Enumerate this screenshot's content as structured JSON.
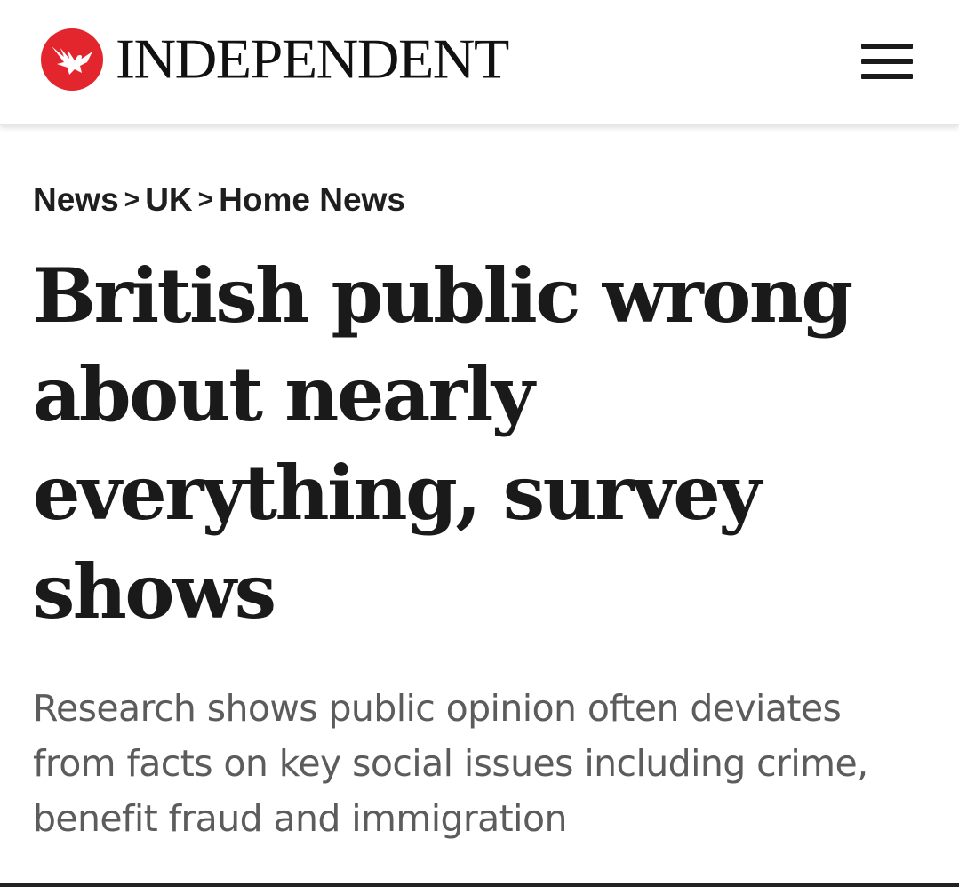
{
  "header": {
    "logo_text": "INDEPENDENT",
    "logo_icon": "eagle-icon",
    "menu_icon": "hamburger-menu-icon",
    "brand_color": "#e3262d"
  },
  "breadcrumb": {
    "items": [
      "News",
      "UK",
      "Home News"
    ],
    "separator": ">"
  },
  "article": {
    "headline": "British public wrong about nearly everything, survey shows",
    "standfirst": "Research shows public opinion often deviates from facts on key social issues including crime, benefit fraud and immigration"
  }
}
